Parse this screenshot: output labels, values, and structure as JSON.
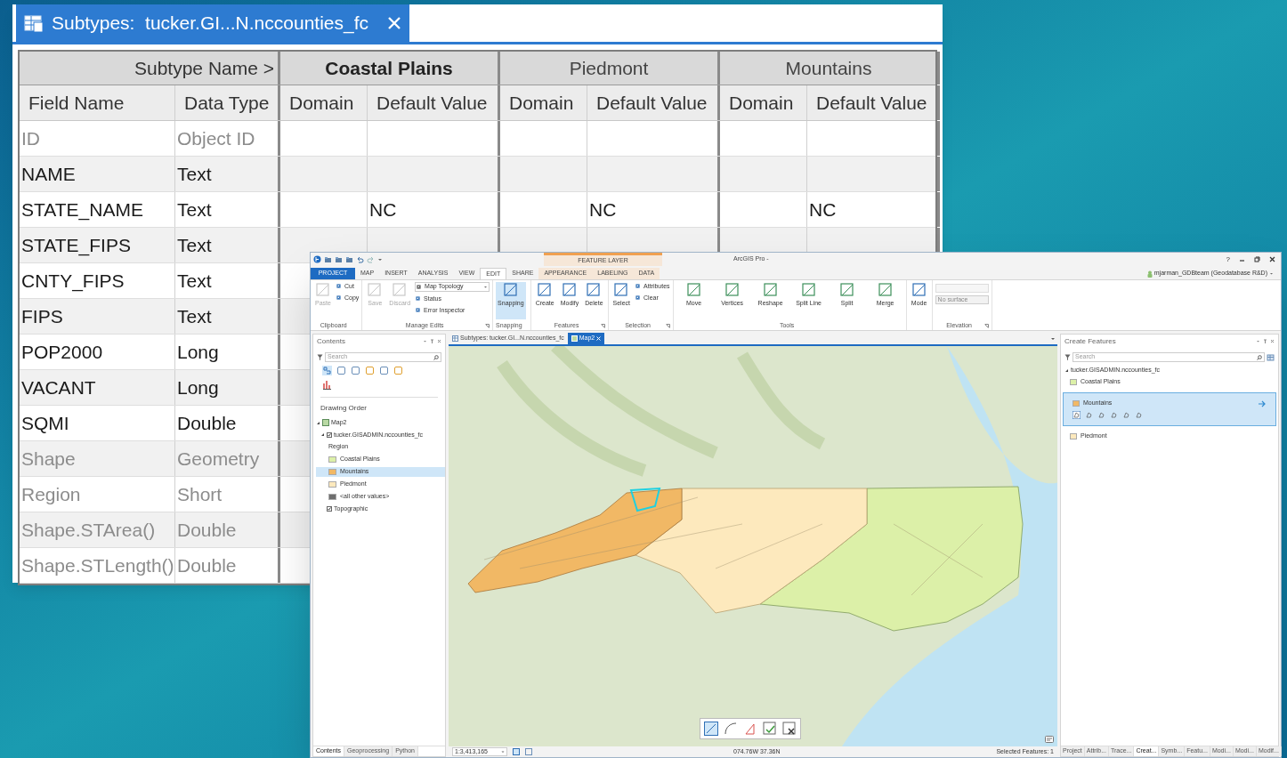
{
  "subtypes_window": {
    "title": "Subtypes:  tucker.GI...N.nccounties_fc",
    "subtype_name_label": "Subtype Name >",
    "subtypes": [
      {
        "name": "Coastal Plains",
        "selected": true,
        "columns": [
          "Domain",
          "Default Value"
        ]
      },
      {
        "name": "Piedmont",
        "selected": false,
        "columns": [
          "Domain",
          "Default Value"
        ]
      },
      {
        "name": "Mountains",
        "selected": false,
        "columns": [
          "Domain",
          "Default Value"
        ]
      }
    ],
    "columns": [
      "Field Name",
      "Data Type"
    ],
    "rows": [
      {
        "field": "ID",
        "type": "Object ID",
        "editable": false
      },
      {
        "field": "NAME",
        "type": "Text",
        "editable": true
      },
      {
        "field": "STATE_NAME",
        "type": "Text",
        "editable": true,
        "defaults": [
          "NC",
          "NC",
          "NC"
        ]
      },
      {
        "field": "STATE_FIPS",
        "type": "Text",
        "editable": true
      },
      {
        "field": "CNTY_FIPS",
        "type": "Text",
        "editable": true
      },
      {
        "field": "FIPS",
        "type": "Text",
        "editable": true
      },
      {
        "field": "POP2000",
        "type": "Long",
        "editable": true
      },
      {
        "field": "VACANT",
        "type": "Long",
        "editable": true
      },
      {
        "field": "SQMI",
        "type": "Double",
        "editable": true
      },
      {
        "field": "Shape",
        "type": "Geometry",
        "editable": false
      },
      {
        "field": "Region",
        "type": "Short",
        "editable": false
      },
      {
        "field": "Shape.STArea()",
        "type": "Double",
        "editable": false
      },
      {
        "field": "Shape.STLength()",
        "type": "Double",
        "editable": false
      }
    ]
  },
  "arcgis_window": {
    "contextual_tab_group": "FEATURE LAYER",
    "app_title": "ArcGIS Pro -",
    "help": "?",
    "user": "mjarman_GDBteam (Geodatabase R&D)",
    "tabs": [
      {
        "label": "PROJECT",
        "kind": "backstage",
        "selected": false
      },
      {
        "label": "MAP",
        "kind": "tab",
        "selected": false
      },
      {
        "label": "INSERT",
        "kind": "tab",
        "selected": false
      },
      {
        "label": "ANALYSIS",
        "kind": "tab",
        "selected": false
      },
      {
        "label": "VIEW",
        "kind": "tab",
        "selected": false
      },
      {
        "label": "EDIT",
        "kind": "tab",
        "selected": true
      },
      {
        "label": "SHARE",
        "kind": "tab",
        "selected": false
      },
      {
        "label": "APPEARANCE",
        "kind": "contextual",
        "selected": false
      },
      {
        "label": "LABELING",
        "kind": "contextual",
        "selected": false
      },
      {
        "label": "DATA",
        "kind": "contextual",
        "selected": false
      }
    ],
    "ribbon_groups": [
      {
        "label": "Clipboard",
        "launcher": false,
        "items": [
          {
            "kind": "large",
            "label": "Paste",
            "disabled": true
          },
          {
            "kind": "small",
            "label": "Cut",
            "disabled": false
          },
          {
            "kind": "small",
            "label": "Copy",
            "disabled": false
          }
        ]
      },
      {
        "label": "Manage Edits",
        "launcher": true,
        "items": [
          {
            "kind": "large",
            "label": "Save",
            "disabled": true
          },
          {
            "kind": "large",
            "label": "Discard",
            "disabled": true
          },
          {
            "kind": "dropdown",
            "label": "Map Topology",
            "disabled": false
          },
          {
            "kind": "small",
            "label": "Status",
            "disabled": false
          },
          {
            "kind": "small",
            "label": "Error Inspector",
            "disabled": false
          }
        ]
      },
      {
        "label": "Snapping",
        "launcher": false,
        "items": [
          {
            "kind": "large",
            "label": "Snapping",
            "disabled": false,
            "on": true
          }
        ]
      },
      {
        "label": "Features",
        "launcher": true,
        "items": [
          {
            "kind": "large",
            "label": "Create",
            "disabled": false
          },
          {
            "kind": "large",
            "label": "Modify",
            "disabled": false
          },
          {
            "kind": "large",
            "label": "Delete",
            "disabled": false
          }
        ]
      },
      {
        "label": "Selection",
        "launcher": true,
        "items": [
          {
            "kind": "large",
            "label": "Select",
            "disabled": false
          },
          {
            "kind": "small",
            "label": "Attributes",
            "disabled": false
          },
          {
            "kind": "small",
            "label": "Clear",
            "disabled": false
          }
        ]
      },
      {
        "label": "Tools",
        "launcher": false,
        "items": [
          {
            "kind": "gallery",
            "label": "Move",
            "disabled": false
          },
          {
            "kind": "gallery",
            "label": "Vertices",
            "disabled": false
          },
          {
            "kind": "gallery",
            "label": "Reshape",
            "disabled": false
          },
          {
            "kind": "gallery",
            "label": "Split Line",
            "disabled": false
          },
          {
            "kind": "gallery",
            "label": "Split",
            "disabled": false
          },
          {
            "kind": "gallery",
            "label": "Merge",
            "disabled": false
          }
        ]
      },
      {
        "launcher": false,
        "items": [
          {
            "kind": "large",
            "label": "Mode",
            "disabled": false
          }
        ]
      },
      {
        "label": "Elevation",
        "launcher": true,
        "items": [
          {
            "kind": "surface",
            "label": "No surface",
            "disabled": true
          }
        ]
      }
    ],
    "contents": {
      "title": "Contents",
      "search_placeholder": "Search",
      "heading": "Drawing Order",
      "tree": [
        {
          "label": "Map2",
          "kind": "map",
          "expanded": true,
          "children": [
            {
              "label": "tucker.GISADMIN.nccounties_fc",
              "kind": "layer",
              "checked": true,
              "expanded": true,
              "field": "Region",
              "classes": [
                {
                  "label": "Coastal Plains",
                  "color": "#dcf0a8",
                  "selected": false
                },
                {
                  "label": "Mountains",
                  "color": "#f1b865",
                  "selected": true
                },
                {
                  "label": "Piedmont",
                  "color": "#fde9bd",
                  "selected": false
                },
                {
                  "label": "<all other values>",
                  "color": "#6e6e6e",
                  "selected": false
                }
              ]
            },
            {
              "label": "Topographic",
              "kind": "basemap",
              "checked": true
            }
          ]
        }
      ]
    },
    "view_tabs": [
      {
        "label": "Subtypes: tucker.GI...N.nccounties_fc",
        "kind": "table",
        "selected": false
      },
      {
        "label": "Map2",
        "kind": "map",
        "selected": true
      }
    ],
    "create_features": {
      "title": "Create Features",
      "search_placeholder": "Search",
      "layer": "tucker.GISADMIN.nccounties_fc",
      "expanded": true,
      "templates": [
        {
          "label": "Coastal Plains",
          "color": "#dcf0a8",
          "selected": false
        },
        {
          "label": "Mountains",
          "color": "#f1b865",
          "selected": true
        },
        {
          "label": "Piedmont",
          "color": "#fde9bd",
          "selected": false
        }
      ]
    },
    "left_pane_tabs": [
      {
        "label": "Contents",
        "selected": true
      },
      {
        "label": "Geoprocessing",
        "selected": false
      },
      {
        "label": "Python",
        "selected": false
      }
    ],
    "status_bar": {
      "scale": "1:3,413,165",
      "coordinates": "074.76W 37.36N",
      "selected_features": "Selected Features: 1"
    },
    "right_pane_tabs": [
      {
        "label": "Project",
        "selected": false
      },
      {
        "label": "Attrib...",
        "selected": false
      },
      {
        "label": "Trace...",
        "selected": false
      },
      {
        "label": "Creat...",
        "selected": true
      },
      {
        "label": "Symb...",
        "selected": false
      },
      {
        "label": "Featu...",
        "selected": false
      },
      {
        "label": "Modi...",
        "selected": false
      },
      {
        "label": "Modi...",
        "selected": false
      },
      {
        "label": "Modif...",
        "selected": false
      }
    ]
  }
}
